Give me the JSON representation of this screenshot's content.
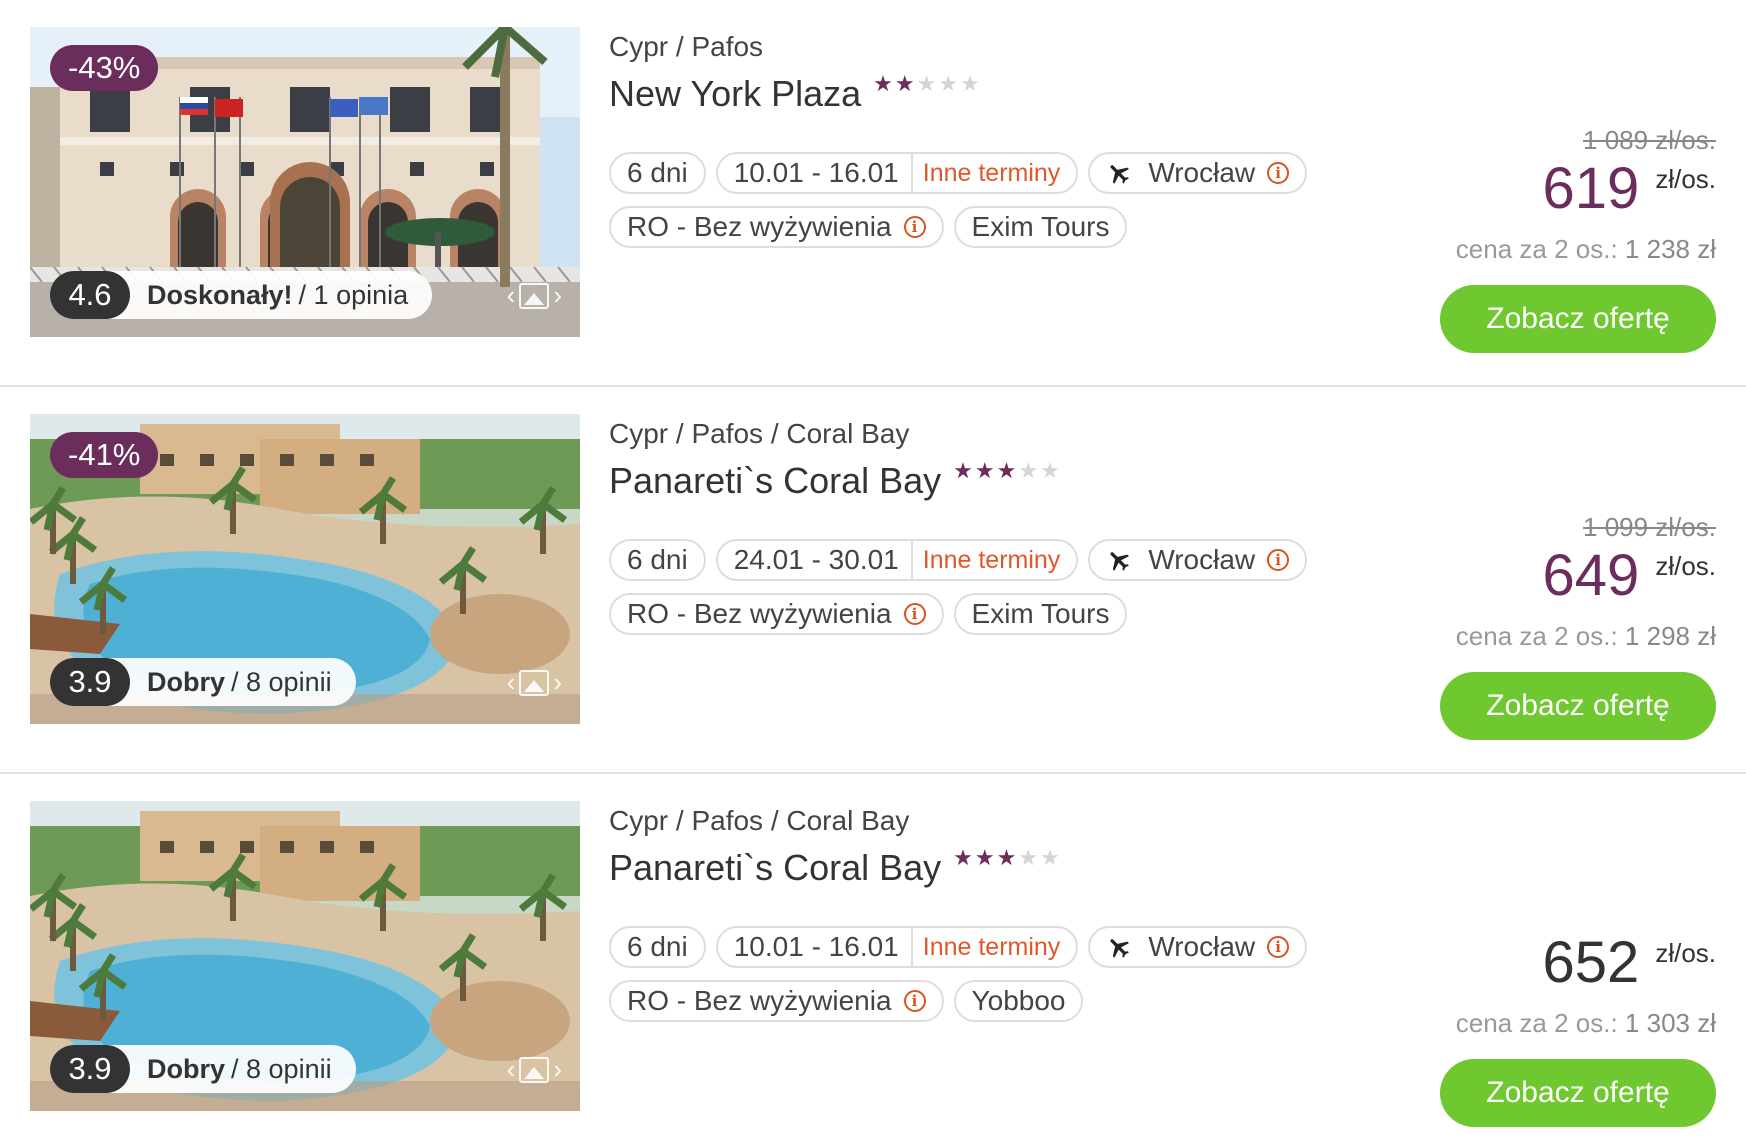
{
  "colors": {
    "accent": "#6b2d5c",
    "button": "#6fc82f",
    "link": "#e0572a"
  },
  "offers": [
    {
      "discount": "-43%",
      "rating": {
        "score": "4.6",
        "verdict": "Doskonały!",
        "opinions": "/ 1 opinia"
      },
      "location": "Cypr / Pafos",
      "name": "New York Plaza",
      "stars": 2,
      "duration": "6 dni",
      "dates": "10.01 - 16.01",
      "other_dates": "Inne terminy",
      "departure": "Wrocław",
      "board": "RO - Bez wyżywienia",
      "operator": "Exim Tours",
      "old_price": "1 089 zł/os.",
      "price": "619",
      "price_unit": "zł/os.",
      "price_color": "#6b2d5c",
      "per_two_label": "cena za 2 os.:",
      "per_two_value": "1 238 zł",
      "cta": "Zobacz ofertę",
      "photo": "hotel-facade"
    },
    {
      "discount": "-41%",
      "rating": {
        "score": "3.9",
        "verdict": "Dobry",
        "opinions": "/ 8 opinii"
      },
      "location": "Cypr / Pafos / Coral Bay",
      "name": "Panareti`s Coral Bay",
      "stars": 3,
      "duration": "6 dni",
      "dates": "24.01 - 30.01",
      "other_dates": "Inne terminy",
      "departure": "Wrocław",
      "board": "RO - Bez wyżywienia",
      "operator": "Exim Tours",
      "old_price": "1 099 zł/os.",
      "price": "649",
      "price_unit": "zł/os.",
      "price_color": "#6b2d5c",
      "per_two_label": "cena za 2 os.:",
      "per_two_value": "1 298 zł",
      "cta": "Zobacz ofertę",
      "photo": "pool-resort"
    },
    {
      "discount": "",
      "rating": {
        "score": "3.9",
        "verdict": "Dobry",
        "opinions": "/ 8 opinii"
      },
      "location": "Cypr / Pafos / Coral Bay",
      "name": "Panareti`s Coral Bay",
      "stars": 3,
      "duration": "6 dni",
      "dates": "10.01 - 16.01",
      "other_dates": "Inne terminy",
      "departure": "Wrocław",
      "board": "RO - Bez wyżywienia",
      "operator": "Yobboo",
      "old_price": "",
      "price": "652",
      "price_unit": "zł/os.",
      "price_color": "#333333",
      "per_two_label": "cena za 2 os.:",
      "per_two_value": "1 303 zł",
      "cta": "Zobacz ofertę",
      "photo": "pool-resort"
    }
  ]
}
